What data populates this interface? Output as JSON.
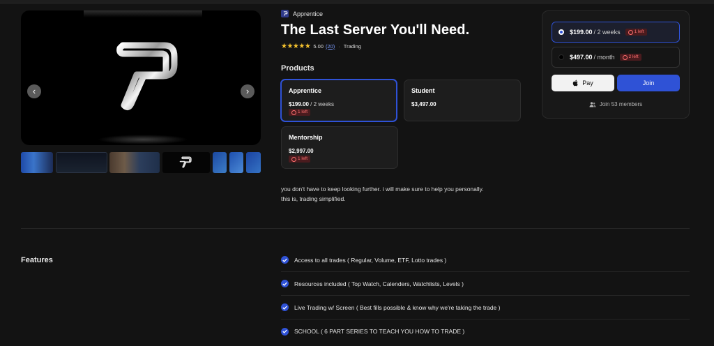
{
  "gallery": {
    "prev_icon": "chevron-left-icon",
    "next_icon": "chevron-right-icon",
    "thumbnail_count": 7
  },
  "brand": {
    "name": "Apprentice"
  },
  "product": {
    "title": "The Last Server You'll Need.",
    "rating": "5.00",
    "review_count": "(20)",
    "category": "Trading",
    "stars": 5
  },
  "products": {
    "heading": "Products",
    "items": [
      {
        "name": "Apprentice",
        "price": "$199.00",
        "period": " / 2 weeks",
        "badge": "1 left"
      },
      {
        "name": "Student",
        "price": "$3,497.00",
        "period": "",
        "badge": ""
      },
      {
        "name": "Mentorship",
        "price": "$2,997.00",
        "period": "",
        "badge": "1 left"
      }
    ]
  },
  "description": {
    "line1": "you don't have to keep looking further. i will make sure to help you personally.",
    "line2": "this is, trading simplified."
  },
  "checkout": {
    "options": [
      {
        "price": "$199.00",
        "period": "/ 2 weeks",
        "badge": "1 left"
      },
      {
        "price": "$497.00",
        "period": "/ month",
        "badge": "2 left"
      }
    ],
    "apple_pay_label": "Pay",
    "join_label": "Join",
    "members_label": "Join 53 members"
  },
  "features": {
    "heading": "Features",
    "items": [
      "Access to all trades ( Regular, Volume, ETF, Lotto trades )",
      "Resources included ( Top Watch, Calenders, Watchlists, Levels )",
      "Live Trading w/ Screen ( Best fills possible & know why we're taking the trade )",
      "SCHOOL ( 6 PART SERIES TO TEACH YOU HOW TO TRADE )"
    ]
  },
  "colors": {
    "accent": "#2f52d6",
    "background": "#131313",
    "badge_text": "#ff7070",
    "star": "#f7c32e"
  }
}
